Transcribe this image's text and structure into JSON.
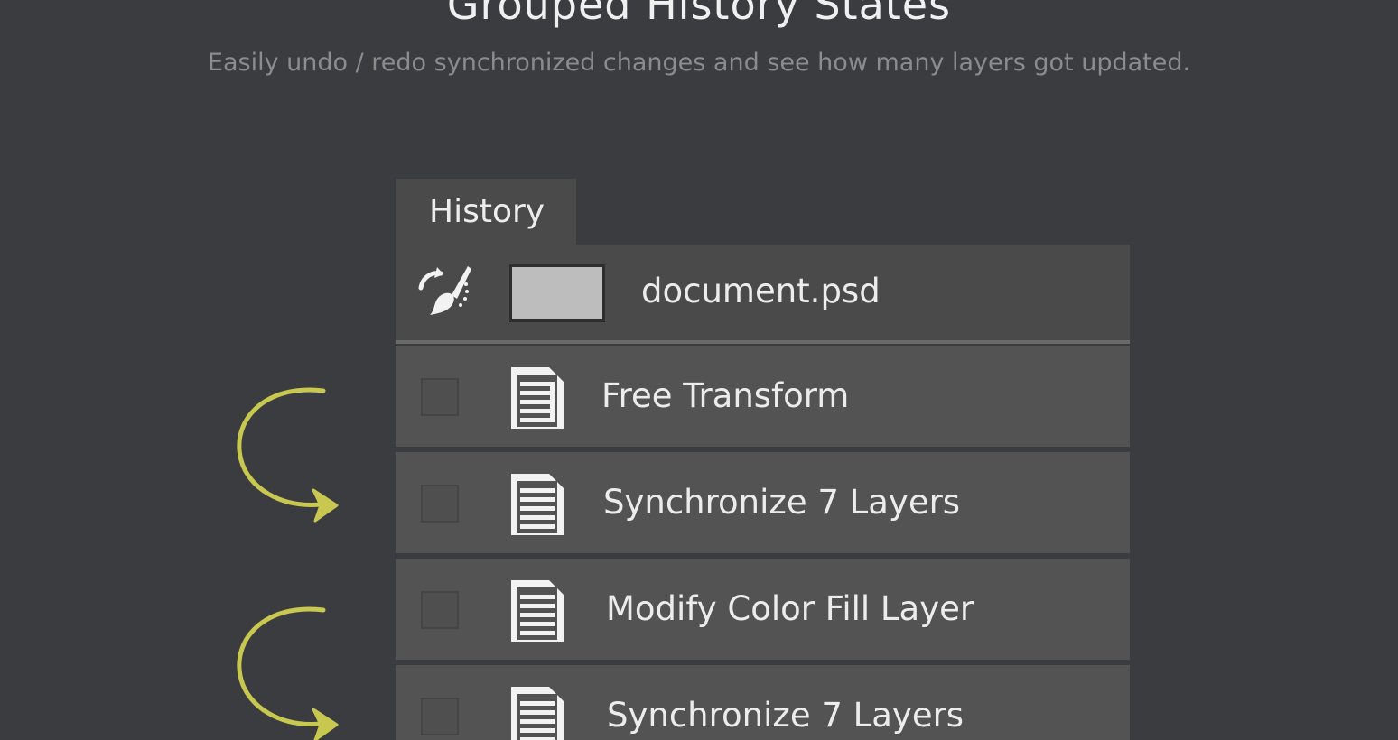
{
  "hero": {
    "title": "Grouped History States",
    "subtitle": "Easily undo / redo synchronized changes and see how many layers got updated."
  },
  "panel": {
    "tab_label": "History",
    "snapshot": {
      "icon": "history-brush-icon",
      "name": "document.psd"
    },
    "states": [
      {
        "label": "Free Transform",
        "icon": "document-icon"
      },
      {
        "label": "Synchronize 7 Layers",
        "icon": "document-icon"
      },
      {
        "label": "Modify Color Fill Layer",
        "icon": "document-icon"
      },
      {
        "label": "Synchronize 7 Layers",
        "icon": "document-icon"
      }
    ]
  },
  "colors": {
    "background": "#3b3c40",
    "panel": "#535353",
    "arrow_accent": "#c8c850"
  }
}
